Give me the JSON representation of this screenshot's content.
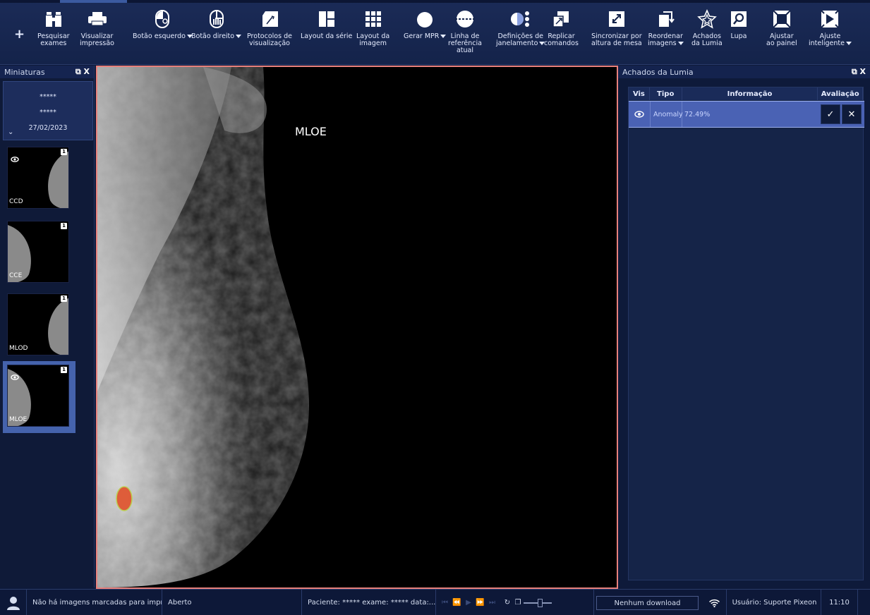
{
  "toolbar": {
    "add_icon": "plus-icon",
    "tools": [
      {
        "id": "search",
        "icon": "binoculars-icon",
        "label": "Pesquisar\nexames",
        "dropdown": false
      },
      {
        "id": "print",
        "icon": "printer-icon",
        "label": "Visualizar\nimpressão",
        "dropdown": false
      },
      {
        "id": "left-button",
        "icon": "mouse-left-icon",
        "label": "Botão esquerdo",
        "dropdown": true
      },
      {
        "id": "right-button",
        "icon": "mouse-hand-icon",
        "label": "Botão direito",
        "dropdown": true
      },
      {
        "id": "protocols",
        "icon": "protocol-icon",
        "label": "Protocolos de\nvisualização",
        "dropdown": false
      },
      {
        "id": "series-layout",
        "icon": "series-layout-icon",
        "label": "Layout da série",
        "dropdown": false
      },
      {
        "id": "image-layout",
        "icon": "grid-layout-icon",
        "label": "Layout da\nimagem",
        "dropdown": false
      },
      {
        "id": "mpr",
        "icon": "sphere-icon",
        "label": "Gerar MPR",
        "dropdown": true
      },
      {
        "id": "ref-line",
        "icon": "reference-line-icon",
        "label": "Linha de\nreferência\natual",
        "dropdown": false
      },
      {
        "id": "windowing",
        "icon": "windowing-icon",
        "label": "Definições de\njanelamento",
        "dropdown": true
      },
      {
        "id": "replicate",
        "icon": "replicate-icon",
        "label": "Replicar\ncomandos",
        "dropdown": false
      },
      {
        "id": "sync",
        "icon": "sync-icon",
        "label": "Sincronizar por\naltura de mesa",
        "dropdown": false
      },
      {
        "id": "reorder",
        "icon": "reorder-icon",
        "label": "Reordenar\nimagens",
        "dropdown": true
      },
      {
        "id": "lumia",
        "icon": "lumia-star-icon",
        "label": "Achados\nda Lumia",
        "dropdown": false
      },
      {
        "id": "magnifier",
        "icon": "magnifier-icon",
        "label": "Lupa",
        "dropdown": false
      },
      {
        "id": "fit-panel",
        "icon": "fit-panel-icon",
        "label": "Ajustar\nao painel",
        "dropdown": false
      },
      {
        "id": "smart-fit",
        "icon": "smart-fit-icon",
        "label": "Ajuste\ninteligente",
        "dropdown": true
      }
    ]
  },
  "left_panel": {
    "title": "Miniaturas",
    "study": {
      "line1": "*****",
      "line2": "*****",
      "date": "27/02/2023"
    },
    "thumbnails": [
      {
        "label": "CCD",
        "count": "1",
        "visible": true
      },
      {
        "label": "CCE",
        "count": "1",
        "visible": false
      },
      {
        "label": "MLOD",
        "count": "1",
        "visible": false
      },
      {
        "label": "MLOE",
        "count": "1",
        "visible": true,
        "selected": true
      }
    ]
  },
  "viewer": {
    "label": "MLOE",
    "border_color": "#e8807c"
  },
  "right_panel": {
    "title": "Achados da Lumia",
    "columns": [
      "Vis",
      "Tipo",
      "Informação",
      "Avaliação"
    ],
    "rows": [
      {
        "type": "Anomaly",
        "info": "72.49%",
        "accept": "✓",
        "reject": "✕"
      }
    ]
  },
  "statusbar": {
    "print_status": "Não há imagens marcadas para imprimir",
    "state": "Aberto",
    "patient": "Paciente: ***** exame: ***** data:...",
    "downloads": "Nenhum download",
    "user": "Usuário: Suporte Pixeon",
    "time": "11:10"
  },
  "colors": {
    "accent": "#4a62b4",
    "finding": "#e0542e"
  }
}
